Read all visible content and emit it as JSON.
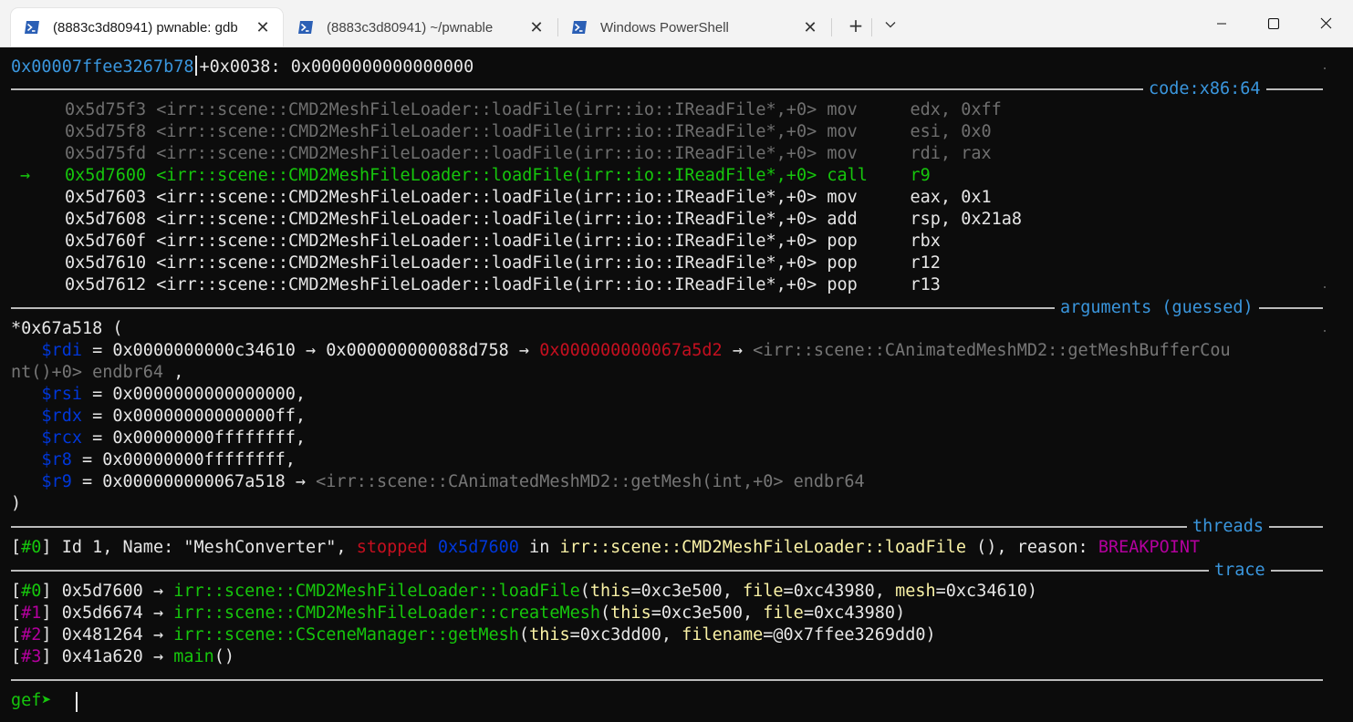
{
  "tabs": [
    {
      "label": "(8883c3d80941) pwnable: gdb",
      "active": true,
      "icon": "powershell-icon"
    },
    {
      "label": "(8883c3d80941) ~/pwnable",
      "active": false,
      "icon": "powershell-icon"
    },
    {
      "label": "Windows PowerShell",
      "active": false,
      "icon": "powershell-icon"
    }
  ],
  "tab_controls": {
    "new_tab": "+",
    "dropdown": "⌄",
    "close": "✕"
  },
  "window_controls": {
    "minimize": "—",
    "maximize": "☐",
    "close": "✕"
  },
  "stack_line": {
    "addr": "0x00007ffee3267b78",
    "offset": "+0x0038: 0x0000000000000000"
  },
  "sections": {
    "code": "code:x86:64",
    "arguments": "arguments (guessed)",
    "threads": "threads",
    "trace": "trace"
  },
  "code_lines": [
    {
      "marker": "",
      "addr": "0x5d75f3",
      "sym": "<irr::scene::CMD2MeshFileLoader::loadFile(irr::io::IReadFile*,+0>",
      "mnemonic": "mov",
      "operands": "edx, 0xff",
      "state": "past"
    },
    {
      "marker": "",
      "addr": "0x5d75f8",
      "sym": "<irr::scene::CMD2MeshFileLoader::loadFile(irr::io::IReadFile*,+0>",
      "mnemonic": "mov",
      "operands": "esi, 0x0",
      "state": "past"
    },
    {
      "marker": "",
      "addr": "0x5d75fd",
      "sym": "<irr::scene::CMD2MeshFileLoader::loadFile(irr::io::IReadFile*,+0>",
      "mnemonic": "mov",
      "operands": "rdi, rax",
      "state": "past"
    },
    {
      "marker": "→",
      "addr": "0x5d7600",
      "sym": "<irr::scene::CMD2MeshFileLoader::loadFile(irr::io::IReadFile*,+0>",
      "mnemonic": "call",
      "operands": "r9",
      "state": "current"
    },
    {
      "marker": "",
      "addr": "0x5d7603",
      "sym": "<irr::scene::CMD2MeshFileLoader::loadFile(irr::io::IReadFile*,+0>",
      "mnemonic": "mov",
      "operands": "eax, 0x1",
      "state": "next"
    },
    {
      "marker": "",
      "addr": "0x5d7608",
      "sym": "<irr::scene::CMD2MeshFileLoader::loadFile(irr::io::IReadFile*,+0>",
      "mnemonic": "add",
      "operands": "rsp, 0x21a8",
      "state": "next"
    },
    {
      "marker": "",
      "addr": "0x5d760f",
      "sym": "<irr::scene::CMD2MeshFileLoader::loadFile(irr::io::IReadFile*,+0>",
      "mnemonic": "pop",
      "operands": "rbx",
      "state": "next"
    },
    {
      "marker": "",
      "addr": "0x5d7610",
      "sym": "<irr::scene::CMD2MeshFileLoader::loadFile(irr::io::IReadFile*,+0>",
      "mnemonic": "pop",
      "operands": "r12",
      "state": "next"
    },
    {
      "marker": "",
      "addr": "0x5d7612",
      "sym": "<irr::scene::CMD2MeshFileLoader::loadFile(irr::io::IReadFile*,+0>",
      "mnemonic": "pop",
      "operands": "r13",
      "state": "next"
    }
  ],
  "arguments": {
    "call": "*0x67a518 (",
    "rdi": {
      "reg": "$rdi",
      "eq": " = 0x0000000000c34610 → 0x000000000088d758 → ",
      "ptr": "0x000000000067a5d2",
      "arrow": " → ",
      "sym": "<irr::scene::CAnimatedMeshMD2::getMeshBufferCou",
      "wrap": "nt()+0> endbr64 ",
      "tail": ","
    },
    "rsi": {
      "reg": "$rsi",
      "eq": " = 0x0000000000000000,"
    },
    "rdx": {
      "reg": "$rdx",
      "eq": " = 0x00000000000000ff,"
    },
    "rcx": {
      "reg": "$rcx",
      "eq": " = 0x00000000ffffffff,"
    },
    "r8": {
      "reg": "$r8",
      "eq": " = 0x00000000ffffffff,"
    },
    "r9": {
      "reg": "$r9",
      "eq": " = 0x000000000067a518 → ",
      "sym": "<irr::scene::CAnimatedMeshMD2::getMesh(int,+0> endbr64"
    },
    "close": ")"
  },
  "thread": {
    "idx": "#0",
    "info": " Id 1, Name: \"MeshConverter\", ",
    "status": "stopped",
    "addr": "0x5d7600",
    "in": " in ",
    "func": "irr::scene::CMD2MeshFileLoader::loadFile",
    "rest": " (), reason: ",
    "reason": "BREAKPOINT"
  },
  "trace": [
    {
      "idx": "#0",
      "addr": " 0x5d7600 → ",
      "func": "irr::scene::CMD2MeshFileLoader::loadFile",
      "args": [
        [
          "this",
          "0xc3e500"
        ],
        [
          "file",
          "0xc43980"
        ],
        [
          "mesh",
          "0xc34610"
        ]
      ]
    },
    {
      "idx": "#1",
      "addr": " 0x5d6674 → ",
      "func": "irr::scene::CMD2MeshFileLoader::createMesh",
      "args": [
        [
          "this",
          "0xc3e500"
        ],
        [
          "file",
          "0xc43980"
        ]
      ]
    },
    {
      "idx": "#2",
      "addr": " 0x481264 → ",
      "func": "irr::scene::CSceneManager::getMesh",
      "args": [
        [
          "this",
          "0xc3dd00"
        ],
        [
          "filename",
          "@0x7ffee3269dd0"
        ]
      ]
    },
    {
      "idx": "#3",
      "addr": " 0x41a620 → ",
      "func": "main",
      "args": []
    }
  ],
  "prompt": "gef➤ "
}
